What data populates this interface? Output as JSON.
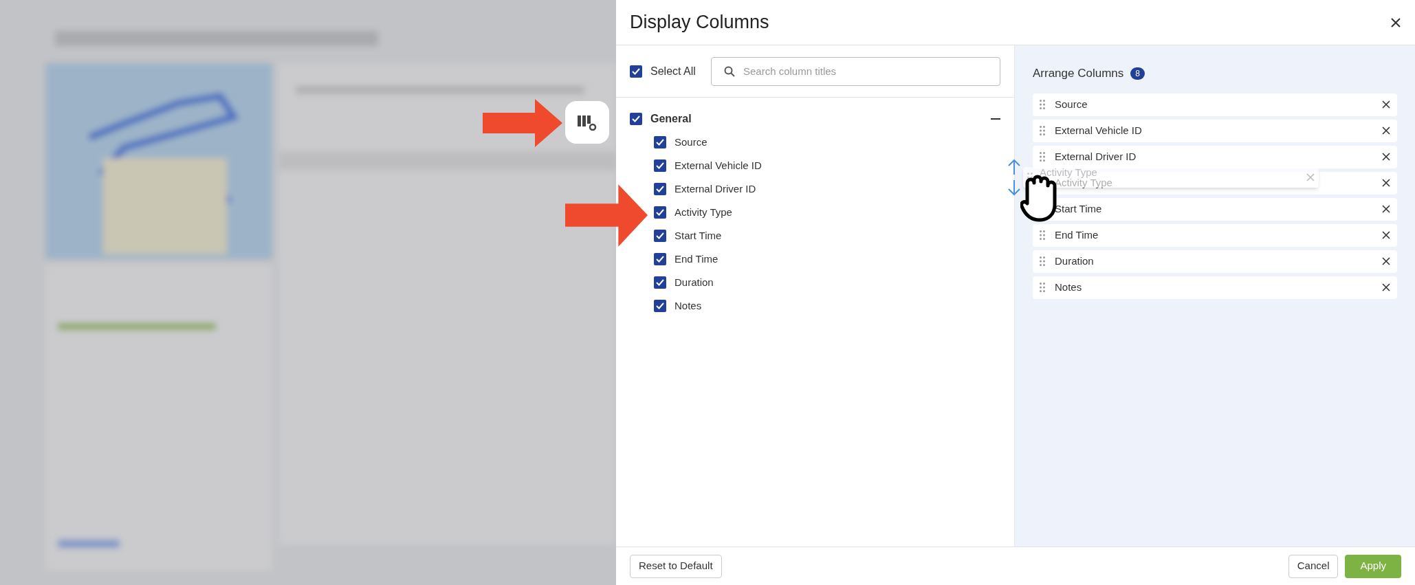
{
  "dialog": {
    "title": "Display Columns"
  },
  "select_all": {
    "label": "Select All",
    "checked": true
  },
  "search": {
    "placeholder": "Search column titles"
  },
  "groups": [
    {
      "label": "General",
      "checked": true,
      "expanded": true,
      "children": [
        {
          "label": "Source",
          "checked": true
        },
        {
          "label": "External Vehicle ID",
          "checked": true
        },
        {
          "label": "External Driver ID",
          "checked": true
        },
        {
          "label": "Activity Type",
          "checked": true
        },
        {
          "label": "Start Time",
          "checked": true
        },
        {
          "label": "End Time",
          "checked": true
        },
        {
          "label": "Duration",
          "checked": true
        },
        {
          "label": "Notes",
          "checked": true
        }
      ]
    }
  ],
  "arrange": {
    "title": "Arrange Columns",
    "count": "8",
    "items": [
      {
        "label": "Source"
      },
      {
        "label": "External Vehicle ID"
      },
      {
        "label": "External Driver ID"
      },
      {
        "label": "Activity Type",
        "handle_covered": true
      },
      {
        "label": "Start Time",
        "handle_covered": true
      },
      {
        "label": "End Time"
      },
      {
        "label": "Duration"
      },
      {
        "label": "Notes"
      }
    ]
  },
  "dragged_item": {
    "label": "Activity Type"
  },
  "footer": {
    "reset": "Reset to Default",
    "cancel": "Cancel",
    "apply": "Apply"
  }
}
